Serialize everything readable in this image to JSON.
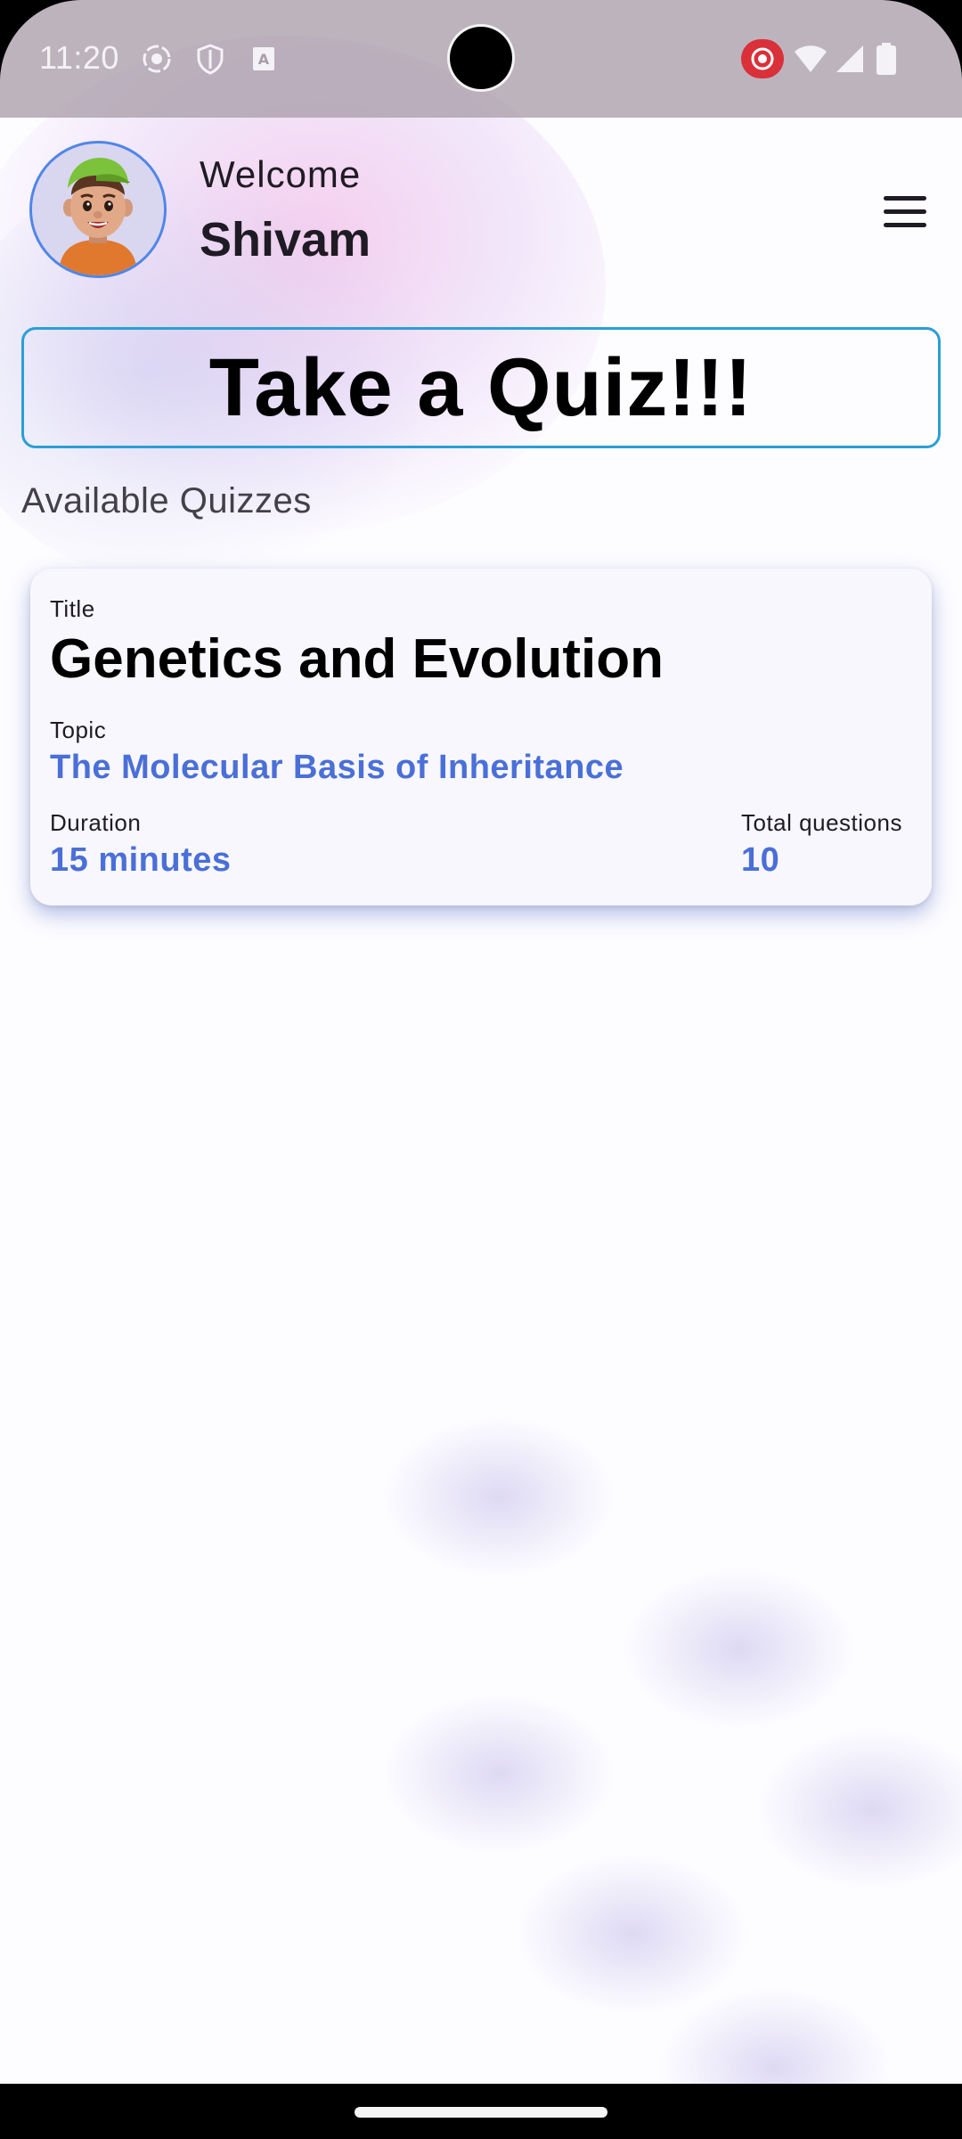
{
  "status_bar": {
    "time": "11:20",
    "icons_left": [
      "record-icon",
      "shield-icon",
      "text-a-icon"
    ],
    "icons_right": [
      "screen-record-icon",
      "wifi-icon",
      "cellular-signal-icon",
      "battery-icon"
    ]
  },
  "header": {
    "welcome": "Welcome",
    "user_name": "Shivam"
  },
  "banner": {
    "label": "Take a Quiz!!!"
  },
  "section": {
    "title": "Available Quizzes"
  },
  "quizzes": [
    {
      "title_label": "Title",
      "title": "Genetics and Evolution",
      "topic_label": "Topic",
      "topic": "The Molecular Basis of Inheritance",
      "duration_label": "Duration",
      "duration": "15 minutes",
      "total_questions_label": "Total questions",
      "total_questions": "10"
    }
  ],
  "colors": {
    "accent_blue": "#4a6fd8",
    "banner_border": "#2a9fd6",
    "avatar_border": "#4f86e8"
  }
}
